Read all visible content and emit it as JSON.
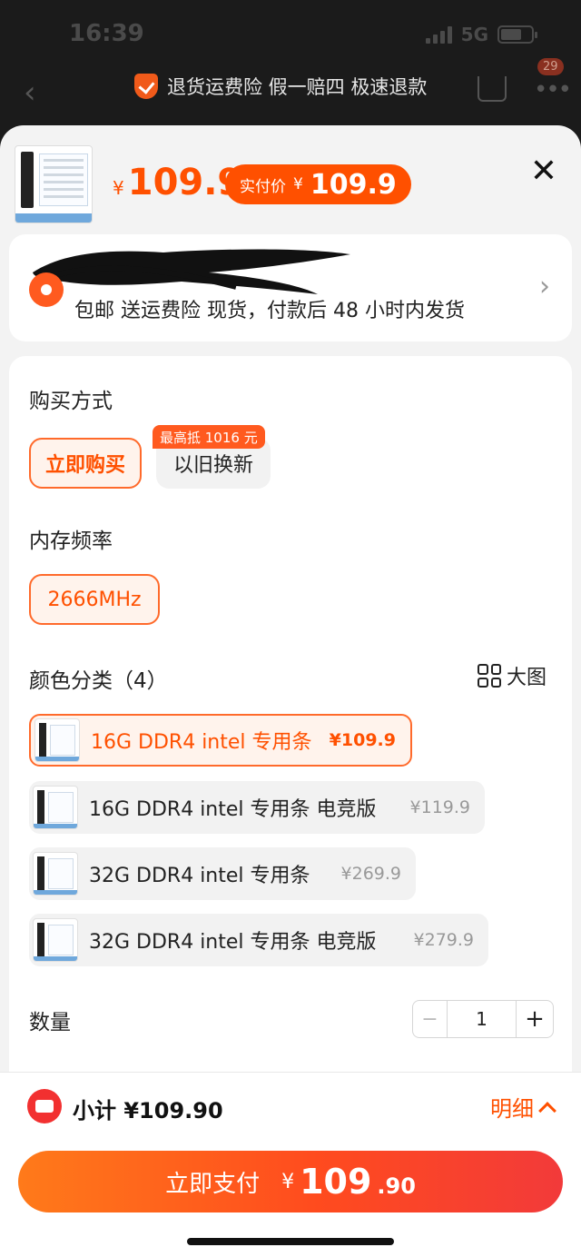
{
  "status_bar": {
    "time": "16:39",
    "network": "5G"
  },
  "nav": {
    "banner": "退货运费险 假一赔四 极速退款",
    "badge_count": "29"
  },
  "product": {
    "price_currency": "¥",
    "price": "109.9",
    "paid_label": "实付价",
    "paid_currency": "¥",
    "paid_price": "109.9"
  },
  "address": {
    "services": "包邮  送运费险  现货，付款后 48 小时内发货"
  },
  "purchase": {
    "title": "购买方式",
    "options": [
      {
        "label": "立即购买",
        "selected": true
      },
      {
        "label": "以旧换新",
        "selected": false
      }
    ],
    "tradein_tag": "最高抵 1016 元"
  },
  "frequency": {
    "title": "内存频率",
    "options": [
      {
        "label": "2666MHz",
        "selected": true
      }
    ]
  },
  "color": {
    "title": "颜色分类（4）",
    "big_image_label": "大图",
    "items": [
      {
        "name": "16G DDR4 intel 专用条",
        "price": "¥109.9",
        "selected": true
      },
      {
        "name": "16G DDR4 intel 专用条  电竞版",
        "price": "¥119.9",
        "selected": false
      },
      {
        "name": "32G DDR4 intel 专用条",
        "price": "¥269.9",
        "selected": false
      },
      {
        "name": "32G DDR4 intel 专用条  电竞版",
        "price": "¥279.9",
        "selected": false
      }
    ]
  },
  "quantity": {
    "title": "数量",
    "value": "1",
    "minus": "−",
    "plus": "+"
  },
  "footer": {
    "subtotal": "小计 ¥109.90",
    "detail_label": "明细",
    "pay_label": "立即支付",
    "pay_currency": "¥",
    "pay_int": "109",
    "pay_dec": ".90"
  },
  "colors": {
    "accent": "#ff5000",
    "selected_bg": "#fff3ec",
    "pay_gradient_end": "#f23a3a"
  }
}
